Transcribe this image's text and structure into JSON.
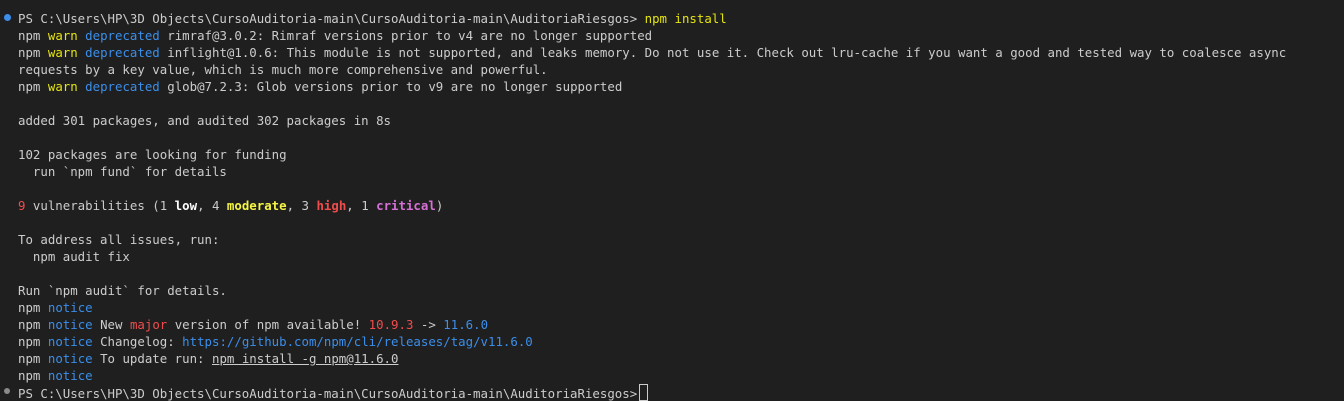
{
  "terminal": {
    "prompt_path": "PS C:\\Users\\HP\\3D Objects\\CursoAuditoria-main\\CursoAuditoria-main\\AuditoriaRiesgos>",
    "command": "npm install",
    "npm": "npm",
    "warn": "warn",
    "deprecated": "deprecated",
    "notice": "notice",
    "warn_1": "rimraf@3.0.2: Rimraf versions prior to v4 are no longer supported",
    "warn_2": "inflight@1.0.6: This module is not supported, and leaks memory. Do not use it. Check out lru-cache if you want a good and tested way to coalesce async requests by a key value, which is much more comprehensive and powerful.",
    "warn_3": "glob@7.2.3: Glob versions prior to v9 are no longer supported",
    "added": "added 301 packages, and audited 302 packages in 8s",
    "funding_1": "102 packages are looking for funding",
    "funding_2": "  run `npm fund` for details",
    "vuln_count": "9",
    "vuln_pre": " vulnerabilities (1 ",
    "vuln_low": "low",
    "vuln_mid1": ", 4 ",
    "vuln_moderate": "moderate",
    "vuln_mid2": ", 3 ",
    "vuln_high": "high",
    "vuln_mid3": ", 1 ",
    "vuln_critical": "critical",
    "vuln_end": ")",
    "address_1": "To address all issues, run:",
    "address_2": "  npm audit fix",
    "run_audit": "Run `npm audit` for details.",
    "notice_new_pre": " New ",
    "notice_major": "major",
    "notice_new_mid": " version of npm available! ",
    "notice_old_ver": "10.9.3",
    "notice_arrow": " -> ",
    "notice_new_ver": "11.6.0",
    "notice_changelog_pre": " Changelog: ",
    "notice_changelog_url": "https://github.com/npm/cli/releases/tag/v11.6.0",
    "notice_update_pre": " To update run: ",
    "notice_update_cmd": "npm install -g npm@11.6.0"
  },
  "colors": {
    "background": "#1f1f1f",
    "text": "#cccccc",
    "yellow": "#e5e510",
    "blue": "#3b8eea",
    "red": "#f14c4c",
    "magenta": "#d670d6"
  }
}
